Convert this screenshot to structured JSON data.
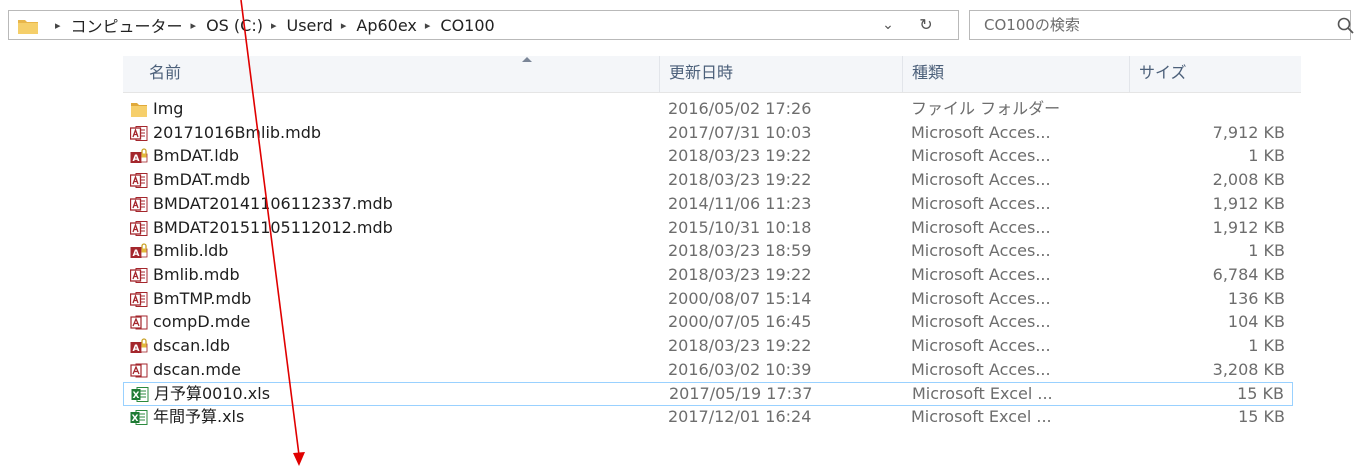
{
  "address_bar": {
    "breadcrumbs": [
      "コンピューター",
      "OS (C:)",
      "Userd",
      "Ap60ex",
      "CO100"
    ],
    "separator": "▸",
    "dropdown_icon": "chevron-down-icon",
    "refresh_icon": "refresh-icon"
  },
  "search": {
    "placeholder": "CO100の検索",
    "icon": "search-icon"
  },
  "columns": {
    "name": "名前",
    "date": "更新日時",
    "type": "種類",
    "size": "サイズ"
  },
  "files": [
    {
      "name": "Img",
      "date": "2016/05/02 17:26",
      "type": "ファイル フォルダー",
      "size": "",
      "icon": "folder-icon"
    },
    {
      "name": "20171016Bmlib.mdb",
      "date": "2017/07/31 10:03",
      "type": "Microsoft Acces...",
      "size": "7,912 KB",
      "icon": "access-db-icon"
    },
    {
      "name": "BmDAT.ldb",
      "date": "2018/03/23 19:22",
      "type": "Microsoft Acces...",
      "size": "1 KB",
      "icon": "access-lock-icon"
    },
    {
      "name": "BmDAT.mdb",
      "date": "2018/03/23 19:22",
      "type": "Microsoft Acces...",
      "size": "2,008 KB",
      "icon": "access-db-icon"
    },
    {
      "name": "BMDAT20141106112337.mdb",
      "date": "2014/11/06 11:23",
      "type": "Microsoft Acces...",
      "size": "1,912 KB",
      "icon": "access-db-icon"
    },
    {
      "name": "BMDAT20151105112012.mdb",
      "date": "2015/10/31 10:18",
      "type": "Microsoft Acces...",
      "size": "1,912 KB",
      "icon": "access-db-icon"
    },
    {
      "name": "Bmlib.ldb",
      "date": "2018/03/23 18:59",
      "type": "Microsoft Acces...",
      "size": "1 KB",
      "icon": "access-lock-icon"
    },
    {
      "name": "Bmlib.mdb",
      "date": "2018/03/23 19:22",
      "type": "Microsoft Acces...",
      "size": "6,784 KB",
      "icon": "access-db-icon"
    },
    {
      "name": "BmTMP.mdb",
      "date": "2000/08/07 15:14",
      "type": "Microsoft Acces...",
      "size": "136 KB",
      "icon": "access-db-icon"
    },
    {
      "name": "compD.mde",
      "date": "2000/07/05 16:45",
      "type": "Microsoft Acces...",
      "size": "104 KB",
      "icon": "access-mde-icon"
    },
    {
      "name": "dscan.ldb",
      "date": "2018/03/23 19:22",
      "type": "Microsoft Acces...",
      "size": "1 KB",
      "icon": "access-lock-icon"
    },
    {
      "name": "dscan.mde",
      "date": "2016/03/02 10:39",
      "type": "Microsoft Acces...",
      "size": "3,208 KB",
      "icon": "access-mde-icon"
    },
    {
      "name": "月予算0010.xls",
      "date": "2017/05/19 17:37",
      "type": "Microsoft Excel ...",
      "size": "15 KB",
      "icon": "excel-icon",
      "selected": true
    },
    {
      "name": "年間予算.xls",
      "date": "2017/12/01 16:24",
      "type": "Microsoft Excel ...",
      "size": "15 KB",
      "icon": "excel-icon"
    }
  ],
  "colors": {
    "annotation": "#e00000",
    "selection_border": "#99d1ff",
    "header_text": "#4c607a"
  }
}
